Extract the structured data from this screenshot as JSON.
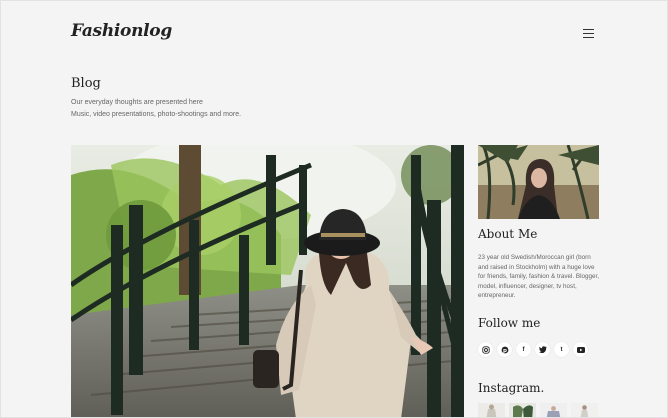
{
  "brand": {
    "logo": "Fashionlog"
  },
  "nav": {
    "menu_icon": "hamburger-menu-icon"
  },
  "page": {
    "title": "Blog",
    "intro_lines": [
      "Our everyday thoughts are presented here",
      "Music, video presentations, photo-shootings and more."
    ]
  },
  "sidebar": {
    "about_title": "About Me",
    "about_text": "23 year old Swedish/Moroccan girl (born and raised in Stockholm) with a huge love for friends, family, fashion & travel. Blogger, model, influencer, designer, tv host, entrepreneur.",
    "follow_title": "Follow me",
    "social_icons": [
      "instagram-icon",
      "pinterest-icon",
      "facebook-icon",
      "twitter-icon",
      "tumblr-icon",
      "youtube-icon"
    ],
    "instagram_title": "Instagram."
  },
  "colors": {
    "background": "#f4f4f4",
    "heading": "#222222",
    "body_text": "#666666"
  }
}
